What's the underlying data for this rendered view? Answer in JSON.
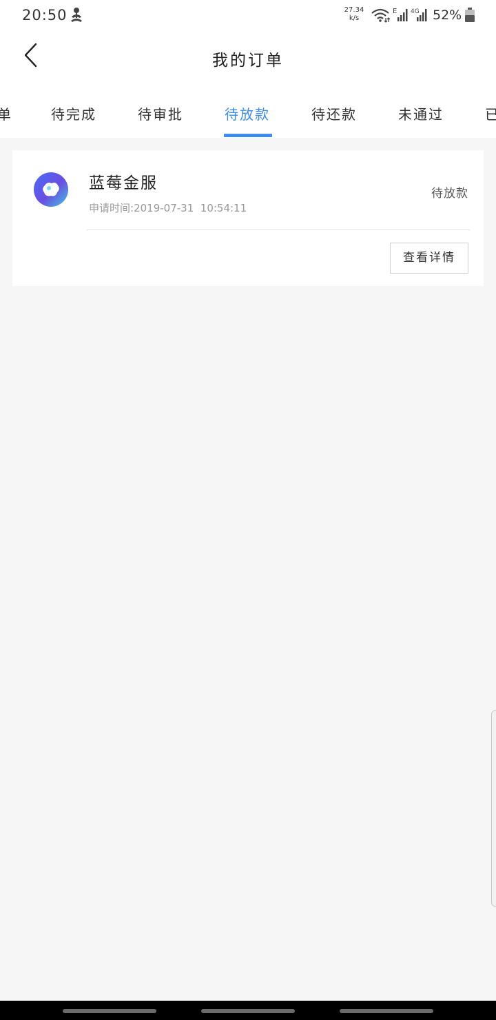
{
  "status_bar": {
    "time": "20:50",
    "net_speed_value": "27.34",
    "net_speed_unit": "k/s",
    "battery_percent": "52%",
    "icons": [
      "app-notification-icon",
      "wifi-icon",
      "signal-e-icon",
      "signal-4g-icon",
      "battery-icon"
    ]
  },
  "header": {
    "title": "我的订单",
    "back_icon": "chevron-left-icon"
  },
  "tabs": {
    "items": [
      {
        "label": "单"
      },
      {
        "label": "待完成"
      },
      {
        "label": "待审批"
      },
      {
        "label": "待放款"
      },
      {
        "label": "待还款"
      },
      {
        "label": "未通过"
      },
      {
        "label": "已"
      }
    ],
    "active": "待放款",
    "accent_color": "#3d8bef"
  },
  "orders": [
    {
      "merchant_name": "蓝莓金服",
      "status": "待放款",
      "apply_time_label": "申请时间:",
      "apply_time_value": "2019-07-31  10:54:11",
      "details_button": "查看详情"
    }
  ]
}
